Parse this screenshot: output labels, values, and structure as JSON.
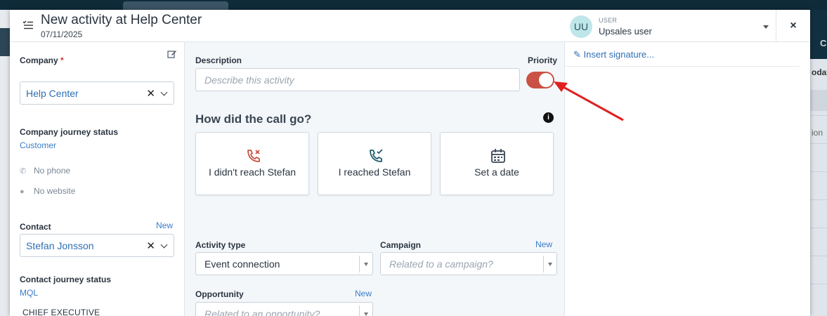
{
  "modal": {
    "title": "New activity at Help Center",
    "date": "07/11/2025",
    "close_label": "×"
  },
  "user": {
    "initials": "UU",
    "label": "USER",
    "name": "Upsales user"
  },
  "sidebar": {
    "company_label": "Company",
    "required_mark": "*",
    "company_value": "Help Center",
    "company_journey_label": "Company journey status",
    "company_journey_value": "Customer",
    "phone": "No phone",
    "website": "No website",
    "contact_label": "Contact",
    "contact_new": "New",
    "contact_value": "Stefan Jonsson",
    "contact_journey_label": "Contact journey status",
    "contact_journey_value": "MQL",
    "contact_title": "CHIEF EXECUTIVE"
  },
  "center": {
    "description_label": "Description",
    "description_placeholder": "Describe this activity",
    "priority_label": "Priority",
    "priority_on": true,
    "question": "How did the call go?",
    "outcomes": [
      {
        "label": "I didn't reach Stefan",
        "icon": "phone-missed-icon"
      },
      {
        "label": "I reached Stefan",
        "icon": "phone-check-icon"
      },
      {
        "label": "Set a date",
        "icon": "calendar-icon"
      }
    ],
    "activity_type_label": "Activity type",
    "activity_type_value": "Event connection",
    "campaign_label": "Campaign",
    "campaign_new": "New",
    "campaign_placeholder": "Related to a campaign?",
    "opportunity_label": "Opportunity",
    "opportunity_new": "New",
    "opportunity_placeholder": "Related to an opportunity?"
  },
  "right": {
    "signature_link": "Insert signature..."
  },
  "background": {
    "right_header": "C",
    "right_today": "oday",
    "right_ion": "ion"
  },
  "colors": {
    "accent": "#3a7bc8",
    "toggle_on": "#c95244",
    "missed_icon": "#c95244",
    "reached_icon": "#1f5b6a",
    "annotation_arrow": "#e02020"
  }
}
